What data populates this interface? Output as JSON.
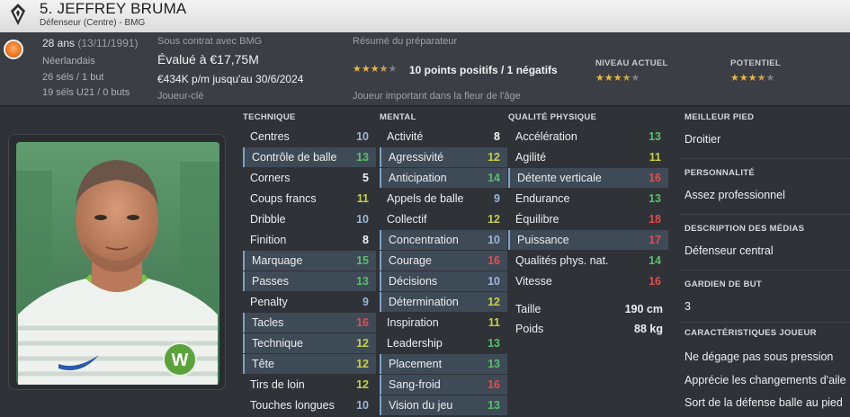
{
  "header": {
    "name": "5. JEFFREY BRUMA",
    "role": "Défenseur (Centre) - BMG"
  },
  "info": {
    "age": "28 ans",
    "dob": "(13/11/1991)",
    "nationality": "Néerlandais",
    "caps": "26 séls / 1 but",
    "u21": "19 séls U21 / 0 buts",
    "contract_label": "Sous contrat avec BMG",
    "value": "Évalué à €17,75M",
    "wage": "€434K p/m jusqu'au 30/6/2024",
    "status": "Joueur-clé",
    "scout_label": "Résumé du préparateur",
    "scout_summary": "10 points positifs / 1 négatifs",
    "scout_note": "Joueur important dans la fleur de l'âge",
    "scout_stars": 3.5,
    "current_label": "NIVEAU ACTUEL",
    "current_stars": 3.5,
    "potential_label": "POTENTIEL",
    "potential_stars": 3.5
  },
  "colors": {
    "star": "#e9b53c",
    "high": "#58c06a",
    "mid": "#c6d145",
    "low": "#e24c4c"
  },
  "technique": {
    "title": "TECHNIQUE",
    "rows": [
      {
        "label": "Centres",
        "value": "10",
        "hl": false
      },
      {
        "label": "Contrôle de balle",
        "value": "13",
        "hl": true
      },
      {
        "label": "Corners",
        "value": "5",
        "hl": false
      },
      {
        "label": "Coups francs",
        "value": "11",
        "hl": false
      },
      {
        "label": "Dribble",
        "value": "10",
        "hl": false
      },
      {
        "label": "Finition",
        "value": "8",
        "hl": false
      },
      {
        "label": "Marquage",
        "value": "15",
        "hl": true
      },
      {
        "label": "Passes",
        "value": "13",
        "hl": true
      },
      {
        "label": "Penalty",
        "value": "9",
        "hl": false
      },
      {
        "label": "Tacles",
        "value": "16",
        "hl": true
      },
      {
        "label": "Technique",
        "value": "12",
        "hl": true
      },
      {
        "label": "Tête",
        "value": "12",
        "hl": true
      },
      {
        "label": "Tirs de loin",
        "value": "12",
        "hl": false
      },
      {
        "label": "Touches longues",
        "value": "10",
        "hl": false
      }
    ]
  },
  "mental": {
    "title": "MENTAL",
    "rows": [
      {
        "label": "Activité",
        "value": "8",
        "hl": false
      },
      {
        "label": "Agressivité",
        "value": "12",
        "hl": true
      },
      {
        "label": "Anticipation",
        "value": "14",
        "hl": true
      },
      {
        "label": "Appels de balle",
        "value": "9",
        "hl": false
      },
      {
        "label": "Collectif",
        "value": "12",
        "hl": false
      },
      {
        "label": "Concentration",
        "value": "10",
        "hl": true
      },
      {
        "label": "Courage",
        "value": "16",
        "hl": true
      },
      {
        "label": "Décisions",
        "value": "10",
        "hl": true
      },
      {
        "label": "Détermination",
        "value": "12",
        "hl": true
      },
      {
        "label": "Inspiration",
        "value": "11",
        "hl": false
      },
      {
        "label": "Leadership",
        "value": "13",
        "hl": false
      },
      {
        "label": "Placement",
        "value": "13",
        "hl": true
      },
      {
        "label": "Sang-froid",
        "value": "16",
        "hl": true
      },
      {
        "label": "Vision du jeu",
        "value": "13",
        "hl": true
      }
    ]
  },
  "physical": {
    "title": "QUALITÉ PHYSIQUE",
    "rows": [
      {
        "label": "Accélération",
        "value": "13",
        "hl": false
      },
      {
        "label": "Agilité",
        "value": "11",
        "hl": false
      },
      {
        "label": "Détente verticale",
        "value": "16",
        "hl": true
      },
      {
        "label": "Endurance",
        "value": "13",
        "hl": false
      },
      {
        "label": "Équilibre",
        "value": "18",
        "hl": false
      },
      {
        "label": "Puissance",
        "value": "17",
        "hl": true
      },
      {
        "label": "Qualités phys. nat.",
        "value": "14",
        "hl": false
      },
      {
        "label": "Vitesse",
        "value": "16",
        "hl": false
      }
    ],
    "height_label": "Taille",
    "height": "190 cm",
    "weight_label": "Poids",
    "weight": "88 kg"
  },
  "side": {
    "foot_label": "MEILLEUR PIED",
    "foot": "Droitier",
    "personality_label": "PERSONNALITÉ",
    "personality": "Assez professionnel",
    "media_label": "DESCRIPTION DES MÉDIAS",
    "media": "Défenseur central",
    "gk_label": "GARDIEN DE BUT",
    "gk": "3",
    "traits_label": "CARACTÉRISTIQUES JOUEUR",
    "traits": [
      "Ne dégage pas sous pression",
      "Apprécie les changements d'aile",
      "Sort de la défense balle au pied"
    ]
  }
}
